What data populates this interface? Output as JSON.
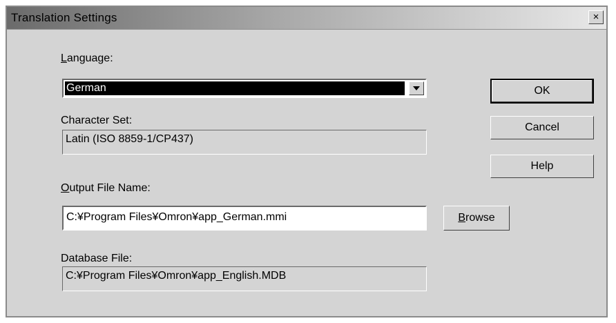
{
  "window": {
    "title": "Translation Settings",
    "close_glyph": "×",
    "close_icon": "close-icon"
  },
  "language": {
    "label_accel": "L",
    "label_rest": "anguage:",
    "selected": "German"
  },
  "character_set": {
    "label": "Character Set:",
    "value": "Latin (ISO 8859-1/CP437)"
  },
  "output_file": {
    "label_accel": "O",
    "label_rest": "utput File Name:",
    "value": "C:¥Program Files¥Omron¥app_German.mmi"
  },
  "database_file": {
    "label": "Database File:",
    "value": "C:¥Program Files¥Omron¥app_English.MDB"
  },
  "buttons": {
    "ok": "OK",
    "cancel": "Cancel",
    "help": "Help",
    "browse_accel": "B",
    "browse_rest": "rowse"
  }
}
